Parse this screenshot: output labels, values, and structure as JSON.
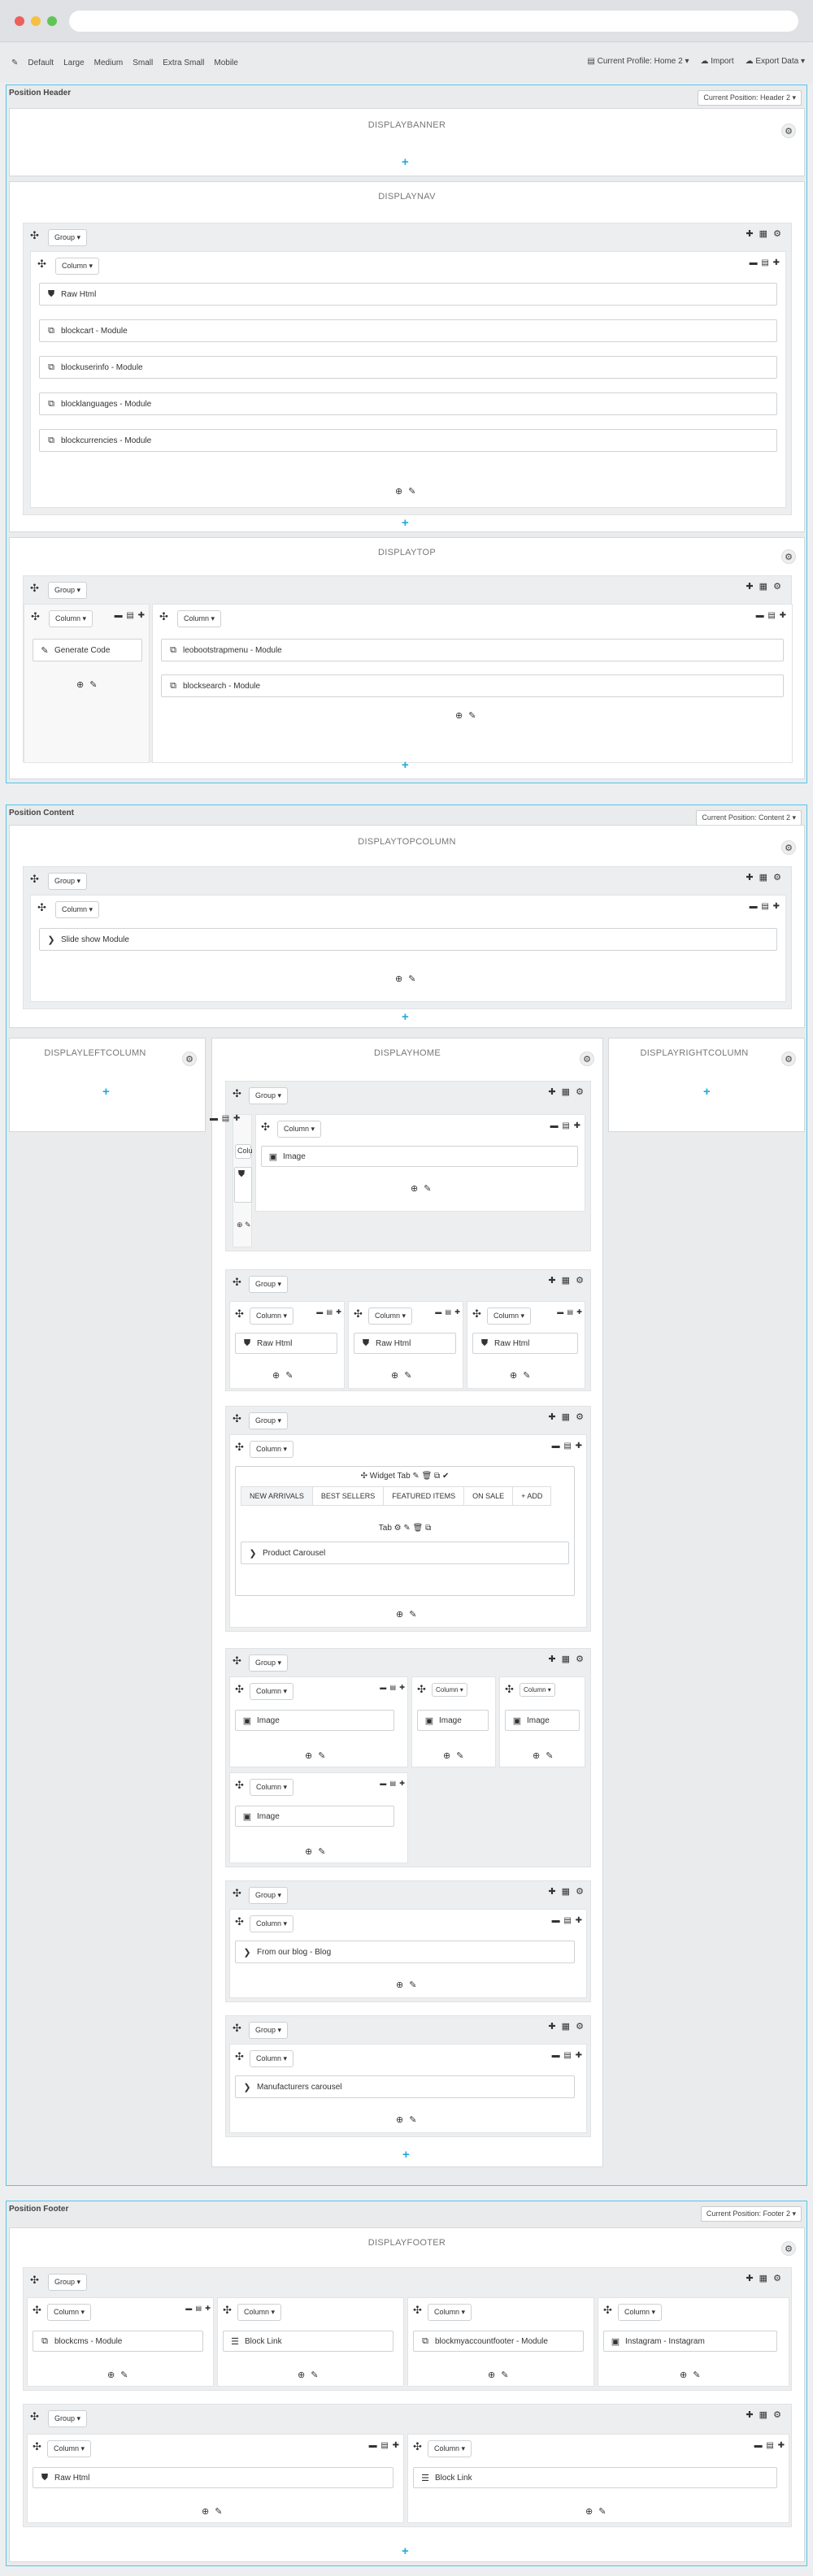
{
  "window": {
    "dot_colors": [
      "#ee5f5b",
      "#f5c040",
      "#61c454"
    ]
  },
  "toolbar": {
    "pencil_icon": "pencil-icon",
    "sizes": [
      "Default",
      "Large",
      "Medium",
      "Small",
      "Extra Small",
      "Mobile"
    ],
    "profile": "Current Profile: Home 2 ▾",
    "import": "Import",
    "export": "Export Data ▾"
  },
  "labels": {
    "group": "Group ▾",
    "column": "Column ▾",
    "col_tools": "⊕ ✎",
    "group_tools": "✚ ▦ ⚙",
    "col_ctrl": "▬ ▤ ✚",
    "gear": "⚙",
    "plus": "+",
    "move": "✣"
  },
  "header": {
    "label": "Position Header",
    "current": "Current Position: Header 2 ▾",
    "banner": "DISPLAYBANNER",
    "nav": "DISPLAYNAV",
    "top": "DISPLAYTOP",
    "nav_modules": [
      "Raw Html",
      "blockcart - Module",
      "blockuserinfo - Module",
      "blocklanguages - Module",
      "blockcurrencies - Module"
    ],
    "top_left_module": "Generate Code",
    "top_right_modules": [
      "leobootstrapmenu - Module",
      "blocksearch - Module"
    ]
  },
  "content": {
    "label": "Position Content",
    "current": "Current Position: Content 2 ▾",
    "topcolumn": "DISPLAYTOPCOLUMN",
    "slideshow": "Slide show Module",
    "left": "DISPLAYLEFTCOLUMN",
    "home": "DISPLAYHOME",
    "right": "DISPLAYRIGHTCOLUMN",
    "image": "Image",
    "raw_html": "Raw Html",
    "raw_html_wrapped": "Raw\nHtm",
    "widget_tab": "Widget Tab",
    "tabs": [
      "NEW ARRIVALS",
      "BEST SELLERS",
      "FEATURED ITEMS",
      "ON SALE",
      "+ ADD"
    ],
    "tab_label": "Tab",
    "product_carousel": "Product Carousel",
    "blog": "From our blog - Blog",
    "manufacturers": "Manufacturers carousel"
  },
  "footer": {
    "label": "Position Footer",
    "current": "Current Position: Footer 2 ▾",
    "hook": "DISPLAYFOOTER",
    "row1": [
      "blockcms - Module",
      "Block Link",
      "blockmyaccountfooter - Module",
      "Instagram - Instagram"
    ],
    "row2": [
      "Raw Html",
      "Block Link"
    ]
  }
}
